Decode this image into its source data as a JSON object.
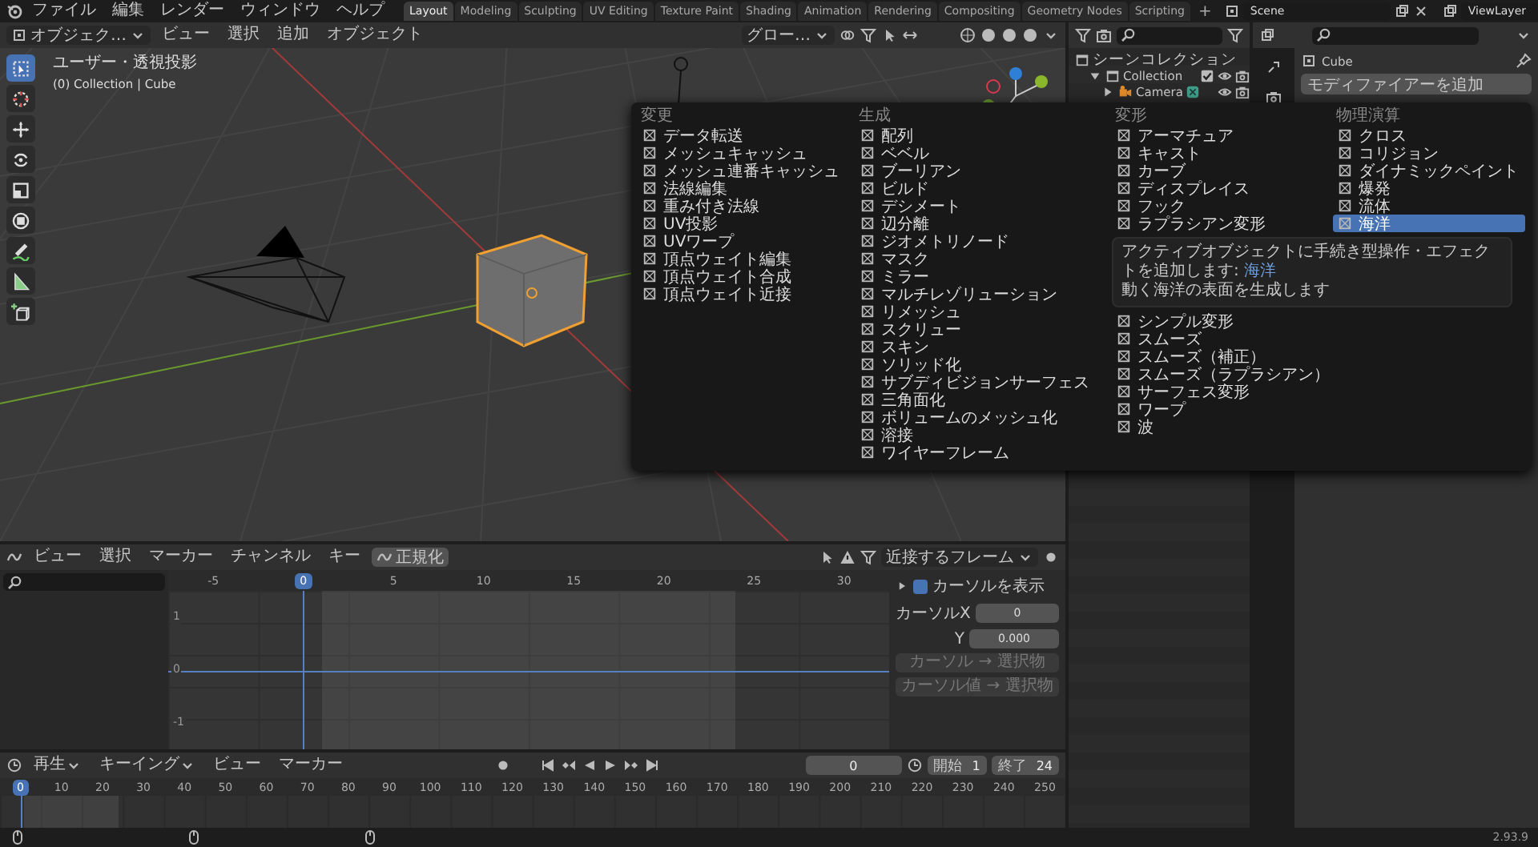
{
  "menubar": {
    "items": [
      "ファイル",
      "編集",
      "レンダー",
      "ウィンドウ",
      "ヘルプ"
    ]
  },
  "workspace_tabs": [
    {
      "label": "Layout",
      "selected": true
    },
    {
      "label": "Modeling",
      "selected": false
    },
    {
      "label": "Sculpting",
      "selected": false
    },
    {
      "label": "UV Editing",
      "selected": false
    },
    {
      "label": "Texture Paint",
      "selected": false
    },
    {
      "label": "Shading",
      "selected": false
    },
    {
      "label": "Animation",
      "selected": false
    },
    {
      "label": "Rendering",
      "selected": false
    },
    {
      "label": "Compositing",
      "selected": false
    },
    {
      "label": "Geometry Nodes",
      "selected": false
    },
    {
      "label": "Scripting",
      "selected": false
    }
  ],
  "add_tab": "+",
  "scene": {
    "value": "Scene"
  },
  "view_layer": {
    "value": "ViewLayer"
  },
  "viewport": {
    "mode": "オブジェク…",
    "menus": [
      "ビュー",
      "選択",
      "追加",
      "オブジェクト"
    ],
    "orientation": "グロー…",
    "tools": [
      {
        "kind": "select",
        "selected": true
      },
      {
        "kind": "cursor",
        "selected": false
      },
      {
        "kind": "move",
        "selected": false
      },
      {
        "kind": "rotate",
        "selected": false
      },
      {
        "kind": "scale",
        "selected": false
      },
      {
        "kind": "transform",
        "selected": false
      },
      {
        "kind": "annotate",
        "selected": false
      },
      {
        "kind": "measure",
        "selected": false
      },
      {
        "kind": "add_cube",
        "selected": false
      }
    ],
    "view_label": "ユーザー・透視投影",
    "collection_label": "(0) Collection | Cube"
  },
  "outliner": {
    "tree": [
      {
        "label": "シーンコレクション",
        "children": [
          {
            "label": "Collection",
            "expanded": true,
            "checked": true,
            "children": [
              {
                "label": "Camera",
                "expanded": false
              }
            ]
          }
        ]
      }
    ]
  },
  "properties": {
    "object": "Cube",
    "add_modifier": "モディファイアーを追加"
  },
  "modifier_menu": {
    "columns": [
      {
        "header": "変更",
        "items": [
          {
            "label": "データ転送",
            "selected": false
          },
          {
            "label": "メッシュキャッシュ",
            "selected": false
          },
          {
            "label": "メッシュ連番キャッシュ",
            "selected": false
          },
          {
            "label": "法線編集",
            "selected": false
          },
          {
            "label": "重み付き法線",
            "selected": false
          },
          {
            "label": "UV投影",
            "selected": false
          },
          {
            "label": "UVワープ",
            "selected": false
          },
          {
            "label": "頂点ウェイト編集",
            "selected": false
          },
          {
            "label": "頂点ウェイト合成",
            "selected": false
          },
          {
            "label": "頂点ウェイト近接",
            "selected": false
          }
        ]
      },
      {
        "header": "生成",
        "items": [
          {
            "label": "配列",
            "selected": false
          },
          {
            "label": "ベベル",
            "selected": false
          },
          {
            "label": "ブーリアン",
            "selected": false
          },
          {
            "label": "ビルド",
            "selected": false
          },
          {
            "label": "デシメート",
            "selected": false
          },
          {
            "label": "辺分離",
            "selected": false
          },
          {
            "label": "ジオメトリノード",
            "selected": false
          },
          {
            "label": "マスク",
            "selected": false
          },
          {
            "label": "ミラー",
            "selected": false
          },
          {
            "label": "マルチレゾリューション",
            "selected": false
          },
          {
            "label": "リメッシュ",
            "selected": false
          },
          {
            "label": "スクリュー",
            "selected": false
          },
          {
            "label": "スキン",
            "selected": false
          },
          {
            "label": "ソリッド化",
            "selected": false
          },
          {
            "label": "サブディビジョンサーフェス",
            "selected": false
          },
          {
            "label": "三角面化",
            "selected": false
          },
          {
            "label": "ボリュームのメッシュ化",
            "selected": false
          },
          {
            "label": "溶接",
            "selected": false
          },
          {
            "label": "ワイヤーフレーム",
            "selected": false
          }
        ]
      }
    ],
    "deform": {
      "header": "変形",
      "items_top": [
        {
          "label": "アーマチュア",
          "selected": false
        },
        {
          "label": "キャスト",
          "selected": false
        },
        {
          "label": "カーブ",
          "selected": false
        },
        {
          "label": "ディスプレイス",
          "selected": false
        },
        {
          "label": "フック",
          "selected": false
        },
        {
          "label": "ラプラシアン変形",
          "selected": false
        }
      ],
      "items_bottom": [
        {
          "label": "シンプル変形",
          "selected": false
        },
        {
          "label": "スムーズ",
          "selected": false
        },
        {
          "label": "スムーズ（補正）",
          "selected": false
        },
        {
          "label": "スムーズ（ラプラシアン）",
          "selected": false
        },
        {
          "label": "サーフェス変形",
          "selected": false
        },
        {
          "label": "ワープ",
          "selected": false
        },
        {
          "label": "波",
          "selected": false
        }
      ]
    },
    "physics": {
      "header": "物理演算",
      "items": [
        {
          "label": "クロス",
          "selected": false
        },
        {
          "label": "コリジョン",
          "selected": false
        },
        {
          "label": "ダイナミックペイント",
          "selected": false
        },
        {
          "label": "爆発",
          "selected": false
        },
        {
          "label": "流体",
          "selected": false
        },
        {
          "label": "海洋",
          "selected": true
        }
      ]
    },
    "tooltip": {
      "title": "アクティブオブジェクトに手続き型操作・エフェクトを追加します:",
      "value": "海洋",
      "description": "動く海洋の表面を生成します"
    }
  },
  "graph_editor": {
    "menus": [
      "ビュー",
      "選択",
      "マーカー",
      "チャンネル",
      "キー"
    ],
    "normalize": {
      "label": "正規化",
      "on": false
    },
    "pivot": "近接するフレーム",
    "ruler": [
      {
        "label": "-5",
        "selected": false
      },
      {
        "label": "0",
        "selected": true
      },
      {
        "label": "5",
        "selected": false
      },
      {
        "label": "10",
        "selected": false
      },
      {
        "label": "15",
        "selected": false
      },
      {
        "label": "20",
        "selected": false
      },
      {
        "label": "25",
        "selected": false
      },
      {
        "label": "30",
        "selected": false
      }
    ],
    "y_labels": [
      "1",
      "0",
      "-1"
    ],
    "sidebar": {
      "show_cursor": {
        "label": "カーソルを表示",
        "checked": true
      },
      "cursor_x": {
        "label": "カーソルX",
        "value": "0"
      },
      "cursor_y": {
        "label": "Y",
        "value": "0.000"
      },
      "buttons": [
        {
          "label": "カーソル → 選択物",
          "disabled": true
        },
        {
          "label": "カーソル値 → 選択物",
          "disabled": true
        }
      ]
    }
  },
  "timeline": {
    "menus": [
      {
        "label": "再生",
        "dropdown": true
      },
      {
        "label": "キーイング",
        "dropdown": true
      },
      {
        "label": "ビュー",
        "dropdown": false
      },
      {
        "label": "マーカー",
        "dropdown": false
      }
    ],
    "frame": "0",
    "start": {
      "label": "開始",
      "value": "1"
    },
    "end": {
      "label": "終了",
      "value": "24"
    },
    "ruler": [
      {
        "label": "0",
        "selected": true
      },
      {
        "label": "10",
        "selected": false
      },
      {
        "label": "20",
        "selected": false
      },
      {
        "label": "30",
        "selected": false
      },
      {
        "label": "40",
        "selected": false
      },
      {
        "label": "50",
        "selected": false
      },
      {
        "label": "60",
        "selected": false
      },
      {
        "label": "70",
        "selected": false
      },
      {
        "label": "80",
        "selected": false
      },
      {
        "label": "90",
        "selected": false
      },
      {
        "label": "100",
        "selected": false
      },
      {
        "label": "110",
        "selected": false
      },
      {
        "label": "120",
        "selected": false
      },
      {
        "label": "130",
        "selected": false
      },
      {
        "label": "140",
        "selected": false
      },
      {
        "label": "150",
        "selected": false
      },
      {
        "label": "160",
        "selected": false
      },
      {
        "label": "170",
        "selected": false
      },
      {
        "label": "180",
        "selected": false
      },
      {
        "label": "190",
        "selected": false
      },
      {
        "label": "200",
        "selected": false
      },
      {
        "label": "210",
        "selected": false
      },
      {
        "label": "220",
        "selected": false
      },
      {
        "label": "230",
        "selected": false
      },
      {
        "label": "240",
        "selected": false
      },
      {
        "label": "250",
        "selected": false
      }
    ]
  },
  "status_bar": {
    "version": "2.93.9"
  }
}
